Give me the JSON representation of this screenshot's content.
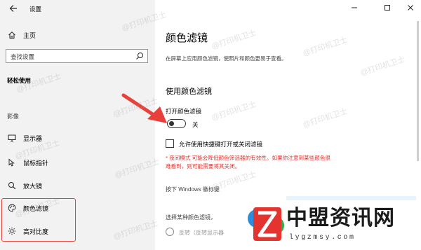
{
  "window": {
    "title": "设置",
    "controls": [
      "minimize",
      "maximize",
      "close"
    ]
  },
  "sidebar": {
    "home_label": "主页",
    "search_placeholder": "查找设置",
    "section_title": "轻松使用",
    "group_label": "影像",
    "items": [
      {
        "label": "显示器",
        "icon": "monitor-icon"
      },
      {
        "label": "鼠标指针",
        "icon": "mouse-pointer-icon"
      },
      {
        "label": "放大镜",
        "icon": "magnifier-icon"
      },
      {
        "label": "颜色滤镜",
        "icon": "color-palette-icon"
      },
      {
        "label": "高对比度",
        "icon": "brightness-icon"
      }
    ]
  },
  "main": {
    "page_title": "颜色滤镜",
    "description": "在屏幕上应用颜色滤镜，使照片和颜色更易于查看。",
    "section_title": "使用颜色滤镜",
    "toggle_label": "打开颜色滤镜",
    "toggle_state": "关",
    "toggle_on": false,
    "checkbox_label": "允许使用快捷键打开或关闭滤镜",
    "checkbox_checked": false,
    "warning_link": "夜间模式",
    "warning_line1": "可能会降低颜色筛选器的有效性。如果你注意到某些颜色很",
    "warning_line2": "难看到，则可能需要将其关闭。",
    "hotkey_text": "按下 Windows 徽标键",
    "select_filter_label": "选择某种颜色滤镜，",
    "radio_option": "反转（反转显示器",
    "warning_color": "#e0312b"
  },
  "annotations": {
    "highlight_color": "#e8413c"
  },
  "watermark": {
    "text": "@打印机卫士"
  },
  "brand": {
    "name": "中盟资讯网",
    "url": "lygzmsy.com"
  }
}
